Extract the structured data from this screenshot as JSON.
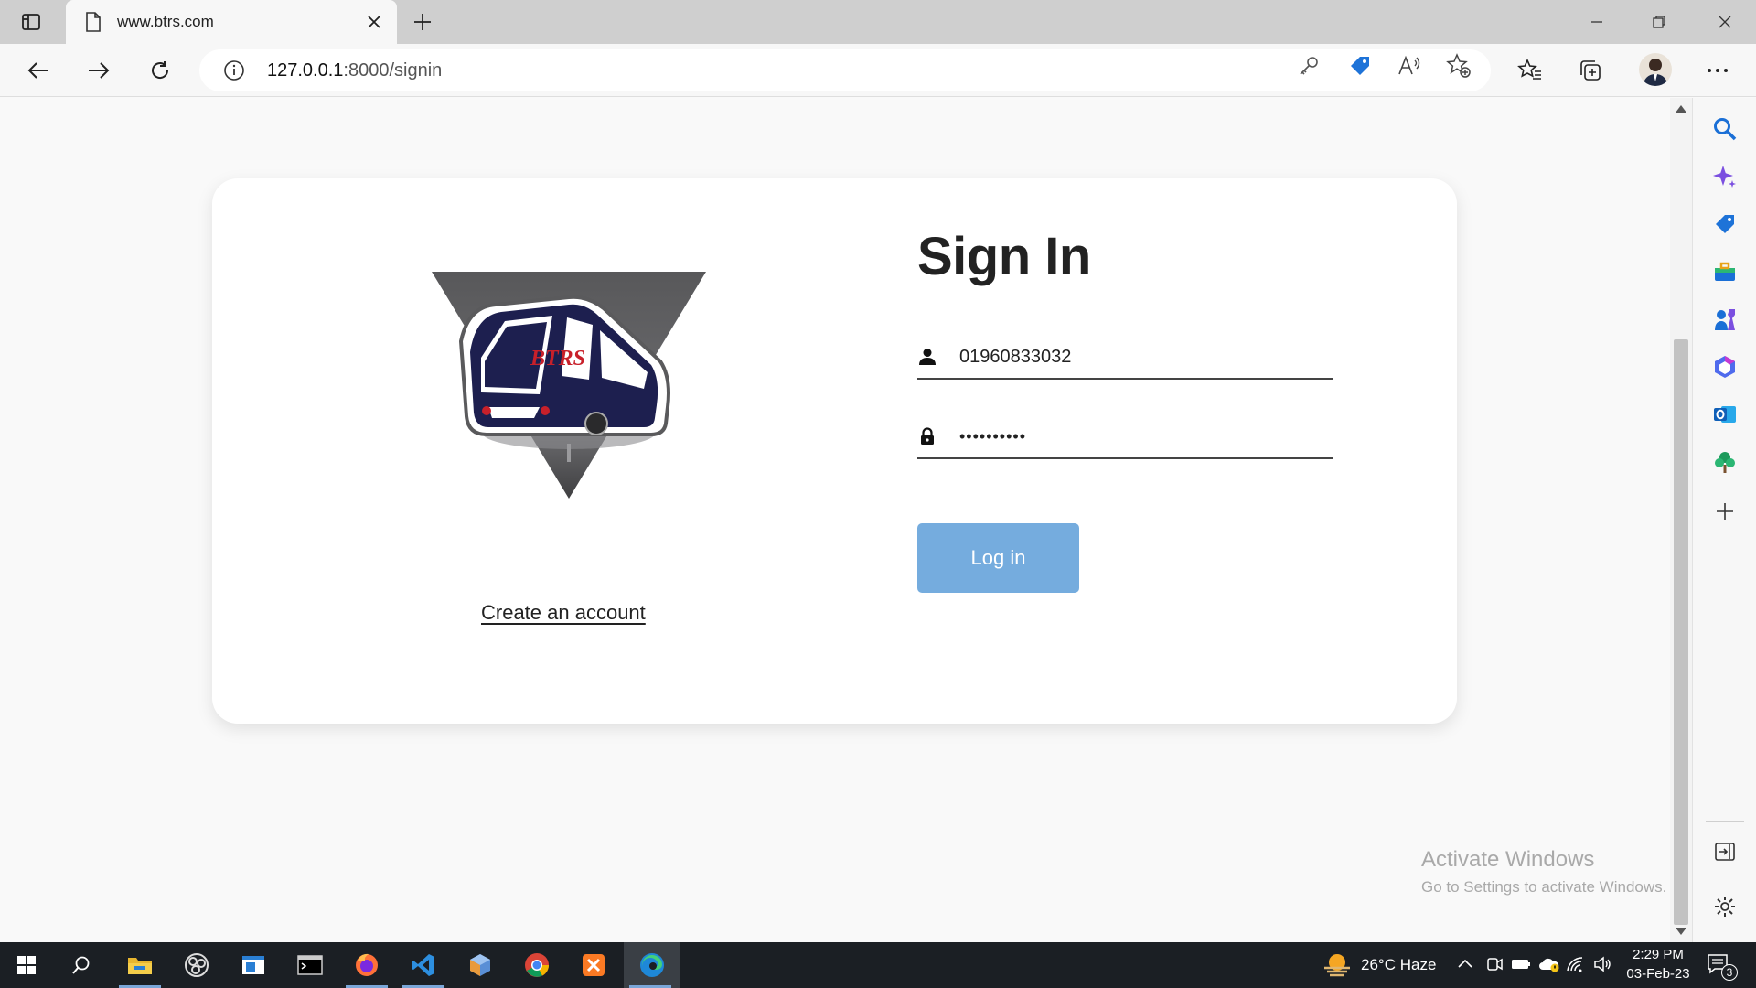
{
  "tab": {
    "title": "www.btrs.com"
  },
  "address": {
    "host": "127.0.0.1",
    "path": ":8000/signin"
  },
  "page": {
    "heading": "Sign In",
    "logo_text": "BTRS",
    "create_account": "Create an account",
    "username_value": "01960833032",
    "password_value": "••••••••••",
    "login_label": "Log in"
  },
  "watermark": {
    "line1": "Activate Windows",
    "line2": "Go to Settings to activate Windows."
  },
  "taskbar": {
    "weather": "26°C Haze",
    "time": "2:29 PM",
    "date": "03-Feb-23",
    "notification_count": "3"
  },
  "colors": {
    "login_button": "#75acde",
    "card_bg": "#ffffff",
    "page_bg": "#f9f9f9",
    "logo_triangle": "#5b5b5d",
    "bus_body": "#1d1f4f",
    "logo_text": "#c8202a"
  },
  "icons": {
    "tab_actions": "tab-actions-icon",
    "page": "page-icon",
    "close": "close-icon",
    "new_tab": "plus-icon",
    "user": "user-icon",
    "lock": "lock-icon"
  }
}
